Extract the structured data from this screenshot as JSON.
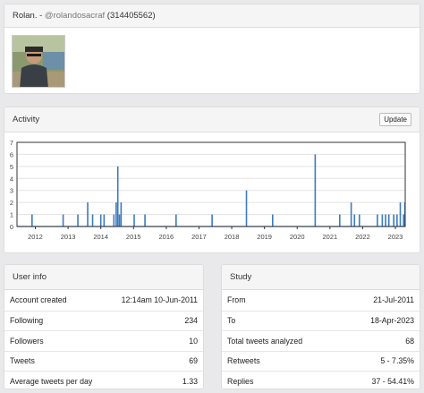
{
  "profile": {
    "name": "Rolan.",
    "separator": "-",
    "handle": "@rolandosacraf",
    "user_id": "(314405562)"
  },
  "activity": {
    "title": "Activity",
    "update_label": "Update"
  },
  "chart_data": {
    "type": "bar",
    "ylim": [
      0,
      7
    ],
    "y_ticks": [
      "0",
      "1",
      "2",
      "3",
      "4",
      "5",
      "6",
      "7"
    ],
    "x_ticks": [
      "2012",
      "2013",
      "2014",
      "2015",
      "2016",
      "2017",
      "2018",
      "2019",
      "2020",
      "2021",
      "2022",
      "2023"
    ],
    "x_range": [
      2011.44,
      2023.3
    ],
    "grid": true,
    "bar_color": "#3b7bbf",
    "points": [
      {
        "x": 2011.9,
        "y": 1
      },
      {
        "x": 2012.85,
        "y": 1
      },
      {
        "x": 2013.3,
        "y": 1
      },
      {
        "x": 2013.6,
        "y": 2
      },
      {
        "x": 2013.75,
        "y": 1
      },
      {
        "x": 2014.0,
        "y": 1
      },
      {
        "x": 2014.1,
        "y": 1
      },
      {
        "x": 2014.4,
        "y": 1
      },
      {
        "x": 2014.47,
        "y": 2
      },
      {
        "x": 2014.52,
        "y": 5
      },
      {
        "x": 2014.57,
        "y": 1
      },
      {
        "x": 2014.62,
        "y": 2
      },
      {
        "x": 2015.02,
        "y": 1
      },
      {
        "x": 2015.35,
        "y": 1
      },
      {
        "x": 2016.3,
        "y": 1
      },
      {
        "x": 2017.4,
        "y": 1
      },
      {
        "x": 2018.45,
        "y": 3
      },
      {
        "x": 2019.25,
        "y": 1
      },
      {
        "x": 2020.55,
        "y": 6
      },
      {
        "x": 2021.3,
        "y": 1
      },
      {
        "x": 2021.65,
        "y": 2
      },
      {
        "x": 2021.75,
        "y": 1
      },
      {
        "x": 2021.9,
        "y": 1
      },
      {
        "x": 2022.45,
        "y": 1
      },
      {
        "x": 2022.6,
        "y": 1
      },
      {
        "x": 2022.7,
        "y": 1
      },
      {
        "x": 2022.8,
        "y": 1
      },
      {
        "x": 2022.95,
        "y": 1
      },
      {
        "x": 2023.05,
        "y": 1
      },
      {
        "x": 2023.15,
        "y": 2
      },
      {
        "x": 2023.25,
        "y": 1
      },
      {
        "x": 2023.29,
        "y": 2
      }
    ]
  },
  "user_info": {
    "title": "User info",
    "rows": [
      {
        "label": "Account created",
        "value": "12:14am 10-Jun-2011"
      },
      {
        "label": "Following",
        "value": "234"
      },
      {
        "label": "Followers",
        "value": "10"
      },
      {
        "label": "Tweets",
        "value": "69"
      },
      {
        "label": "Average tweets per day",
        "value": "1.33"
      }
    ]
  },
  "study": {
    "title": "Study",
    "rows": [
      {
        "label": "From",
        "value": "21-Jul-2011"
      },
      {
        "label": "To",
        "value": "18-Apr-2023"
      },
      {
        "label": "Total tweets analyzed",
        "value": "68"
      },
      {
        "label": "Retweets",
        "value": "5 - 7.35%"
      },
      {
        "label": "Replies",
        "value": "37 - 54.41%"
      }
    ]
  }
}
